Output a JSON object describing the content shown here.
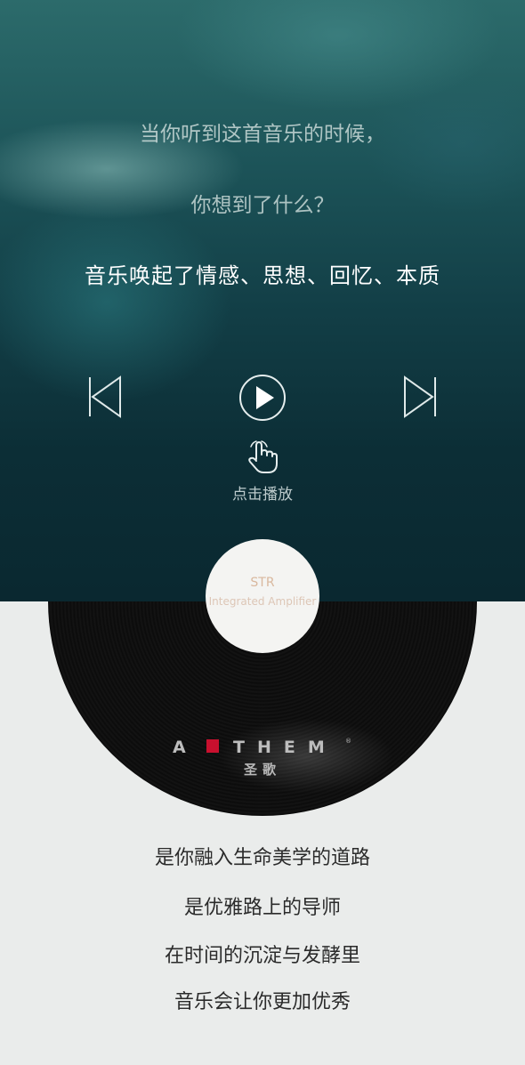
{
  "hero": {
    "line1": "当你听到这首音乐的时候，",
    "line2": "你想到了什么？",
    "line3": "音乐唤起了情感、思想、回忆、本质"
  },
  "controls": {
    "prev_icon": "skip-previous-icon",
    "play_icon": "play-icon",
    "next_icon": "skip-next-icon",
    "hand_icon": "tap-hand-icon",
    "hint": "点击播放"
  },
  "record": {
    "title": "STR",
    "subtitle": "Integrated Amplifier",
    "brand": "ANTHEM",
    "brand_cn": "圣歌"
  },
  "body": {
    "lines": [
      "是你融入生命美学的道路",
      "是优雅路上的导师",
      "在时间的沉淀与发酵里",
      "音乐会让你更加优秀"
    ]
  },
  "colors": {
    "hero_top": "#2c6b6b",
    "hero_bottom": "#0a2830",
    "background": "#eaeceb",
    "accent_red": "#c8102e",
    "label_text": "#d9b89e"
  }
}
